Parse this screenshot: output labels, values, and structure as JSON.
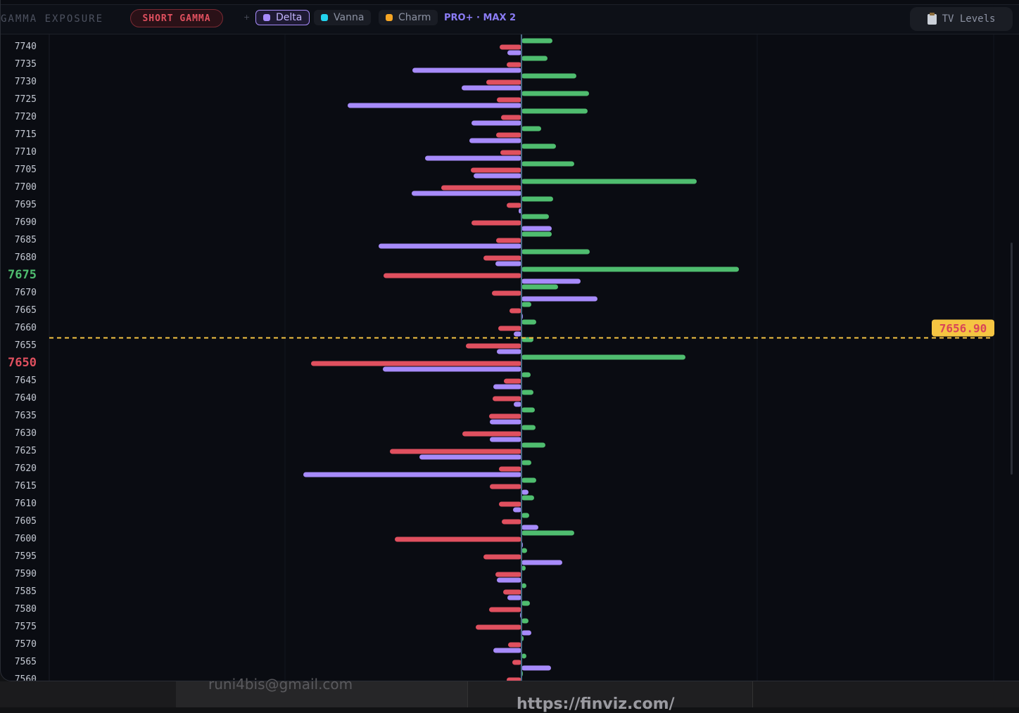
{
  "header": {
    "title": "GAMMA EXPOSURE",
    "regime_badge": "SHORT GAMMA",
    "add_symbol": "+",
    "overlays": [
      {
        "label": "Delta",
        "color": "#a78bfa",
        "active": true
      },
      {
        "label": "Vanna",
        "color": "#22d3ee",
        "active": false
      },
      {
        "label": "Charm",
        "color": "#f5a524",
        "active": false
      }
    ],
    "tier": "PRO+ · MAX 2",
    "tv_levels_label": "TV Levels",
    "tv_levels_icon": "clipboard-icon"
  },
  "background_page": {
    "email_fragment": "runi4bis@gmail.com",
    "url_fragment": "https://finviz.com/"
  },
  "chart_data": {
    "type": "bar",
    "orientation": "horizontal-diverging",
    "spot_price": 7656.9,
    "spot_label": "7656.90",
    "highlighted_strikes": {
      "call_wall": 7675,
      "put_wall": 7650
    },
    "colors": {
      "call_gamma": "#4fbd6f",
      "put_gamma": "#e0505f",
      "delta": "#a78bfa",
      "spot": "#f5c542",
      "call_wall": "#4fbd6f",
      "put_wall": "#e0505f"
    },
    "strike_labels": [
      "7740",
      "7735",
      "7730",
      "7725",
      "7720",
      "7715",
      "7710",
      "7705",
      "7700",
      "7695",
      "7690",
      "7685",
      "7680",
      "7675",
      "7670",
      "7665",
      "7660",
      "7655",
      "7650",
      "7645",
      "7640",
      "7635",
      "7630",
      "7625",
      "7620",
      "7615",
      "7610",
      "7605",
      "7600",
      "7595",
      "7590",
      "7585",
      "7580",
      "7575",
      "7570",
      "7565",
      "7560"
    ],
    "strikes": [
      7740,
      7735,
      7730,
      7725,
      7720,
      7715,
      7710,
      7705,
      7700,
      7695,
      7690,
      7685,
      7680,
      7675,
      7670,
      7665,
      7660,
      7655,
      7650,
      7645,
      7640,
      7635,
      7630,
      7625,
      7620,
      7615,
      7610,
      7605,
      7600,
      7595,
      7590,
      7585,
      7580,
      7575,
      7570,
      7565,
      7560
    ],
    "call_gamma": [
      44,
      37,
      78,
      96,
      94,
      28,
      49,
      75,
      249,
      45,
      39,
      43,
      97,
      309,
      52,
      14,
      21,
      17,
      233,
      13,
      17,
      19,
      20,
      34,
      14,
      21,
      18,
      11,
      75,
      8,
      6,
      7,
      12,
      10,
      3,
      7,
      2
    ],
    "put_gamma": [
      -31,
      -21,
      -50,
      -35,
      -29,
      -36,
      -30,
      -72,
      -114,
      -21,
      -71,
      -36,
      -54,
      -196,
      -42,
      -17,
      -33,
      -79,
      -299,
      -25,
      -41,
      -46,
      -84,
      -187,
      -32,
      -45,
      -32,
      -28,
      -180,
      -54,
      -37,
      -26,
      -46,
      -65,
      -19,
      -13,
      -21
    ],
    "delta": [
      -20,
      -155,
      -85,
      -247,
      -71,
      -74,
      -137,
      -68,
      -156,
      -4,
      43,
      -203,
      -37,
      84,
      108,
      2,
      -11,
      -35,
      -197,
      -40,
      -11,
      -45,
      -45,
      -145,
      -310,
      10,
      -12,
      24,
      2,
      58,
      -35,
      -20,
      -2,
      14,
      -40,
      42,
      -2
    ],
    "xlim": [
      -340,
      340
    ]
  }
}
